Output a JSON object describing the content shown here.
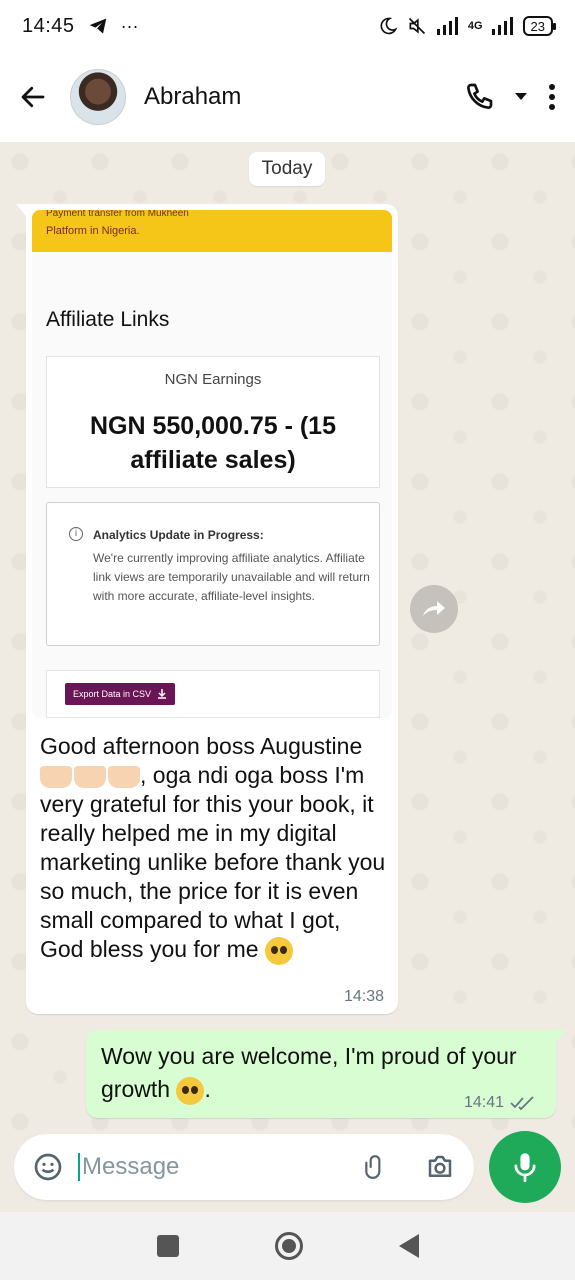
{
  "status_bar": {
    "time": "14:45",
    "dots": "···",
    "network": "4G",
    "battery": "23"
  },
  "header": {
    "contact_name": "Abraham"
  },
  "chat": {
    "date_label": "Today",
    "incoming": {
      "screenshot": {
        "cut_text": "Payment transfer from Mukheen",
        "platform_text": "Platform in Nigeria.",
        "title": "Affiliate Links",
        "earnings_label": "NGN Earnings",
        "earnings_value": "NGN 550,000.75 - (15 affiliate sales)",
        "analytics_title": "Analytics Update in Progress:",
        "analytics_body": "We're currently improving affiliate analytics. Affiliate link views are temporarily unavailable and will return with more accurate, affiliate-level insights.",
        "export_button": "Export Data in CSV"
      },
      "text_part1": "Good afternoon boss Augustine",
      "text_part2": ", oga ndi oga boss I'm very grateful for this your book, it really helped me in my digital marketing unlike before thank you so much, the price for it is even small compared to what I got, God bless you for me",
      "time": "14:38"
    },
    "outgoing": {
      "text": "Wow you are welcome, I'm proud of your growth",
      "text_end": ".",
      "time": "14:41"
    }
  },
  "composer": {
    "placeholder": "Message"
  },
  "colors": {
    "accent_green": "#1faa59",
    "outgoing_bubble": "#d9fdd3",
    "brand_yellow": "#f5c518",
    "csv_button": "#6a1556"
  }
}
